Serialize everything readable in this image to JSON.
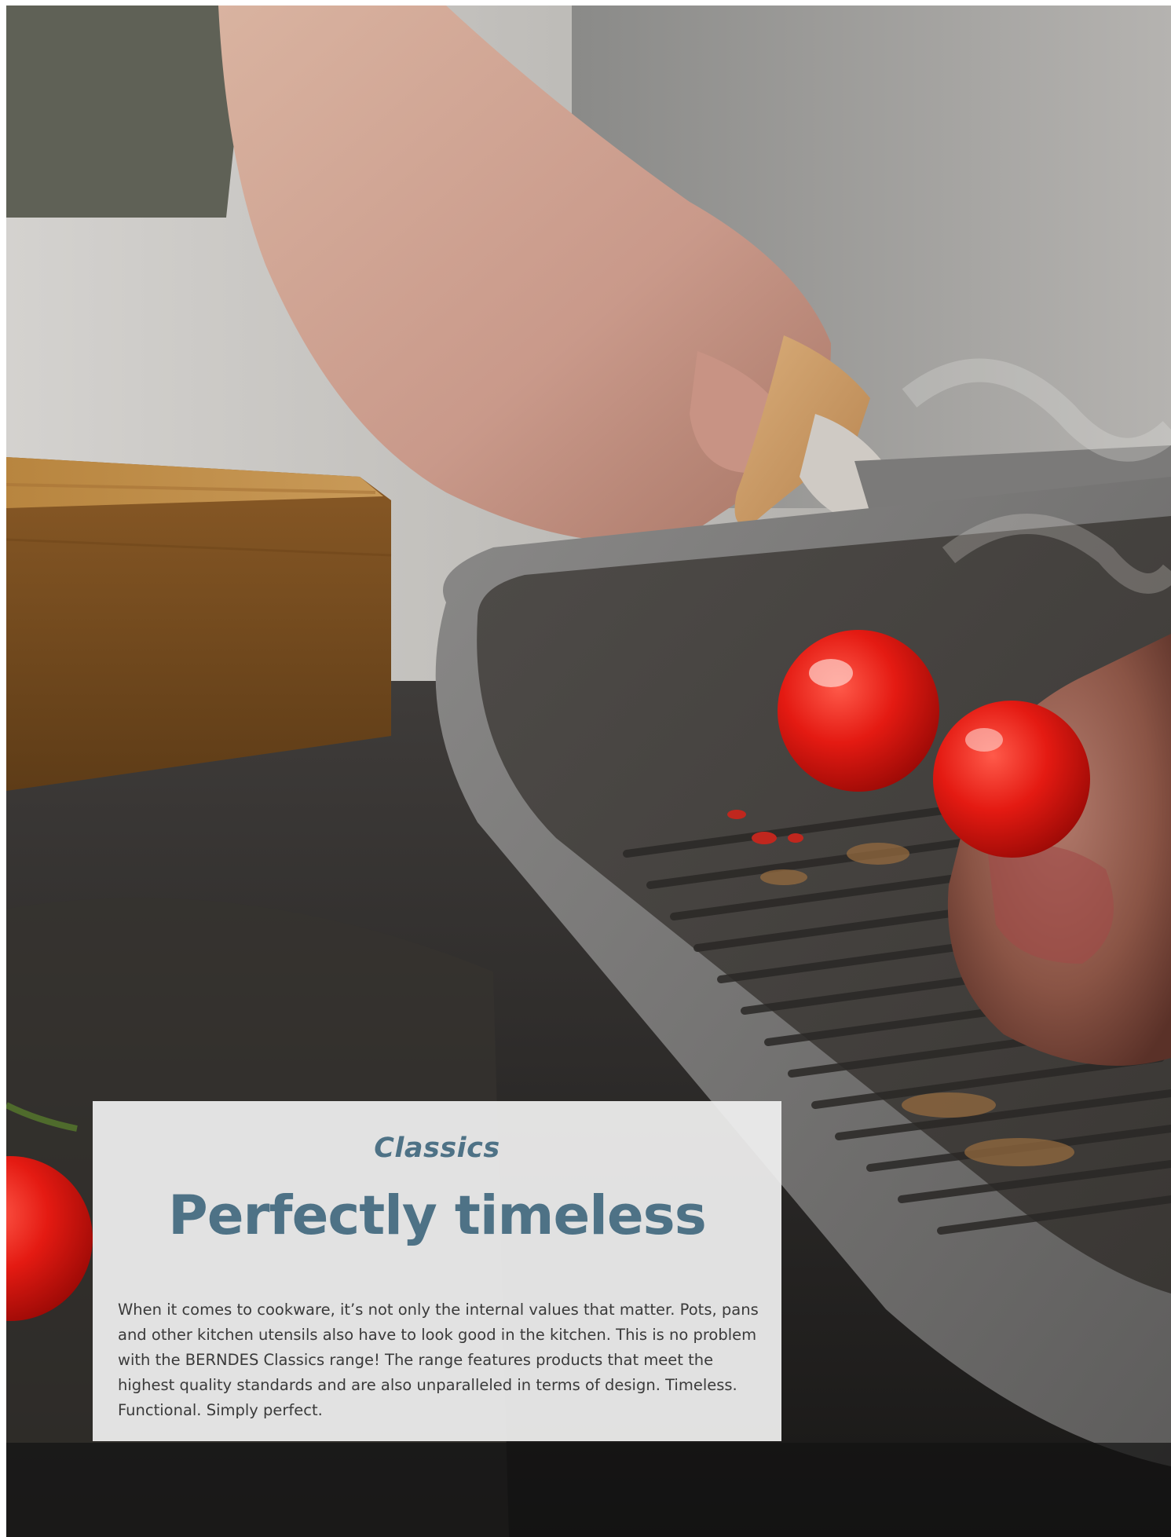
{
  "page": {
    "kicker": "Classics",
    "headline": "Perfectly timeless",
    "body": "When it comes to cookware, it’s not only the internal values that matter. Pots, pans and other kitchen utensils also have to look good in the kitchen. This is no problem with the BERNDES Classics range! The range features products that meet the highest quality standards and are also unparalleled in terms of design. Timeless. Functional. Simply perfect."
  },
  "colors": {
    "accent": "#4e7286",
    "body_text": "#3a3a3a",
    "panel": "#f0f0f0"
  }
}
